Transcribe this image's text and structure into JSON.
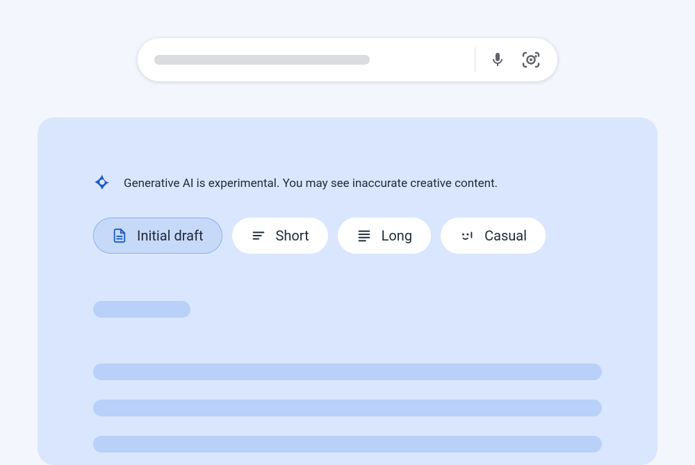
{
  "disclaimer": {
    "text": "Generative AI is experimental. You may see inaccurate creative content."
  },
  "chips": {
    "initial_draft": "Initial draft",
    "short": "Short",
    "long": "Long",
    "casual": "Casual"
  }
}
